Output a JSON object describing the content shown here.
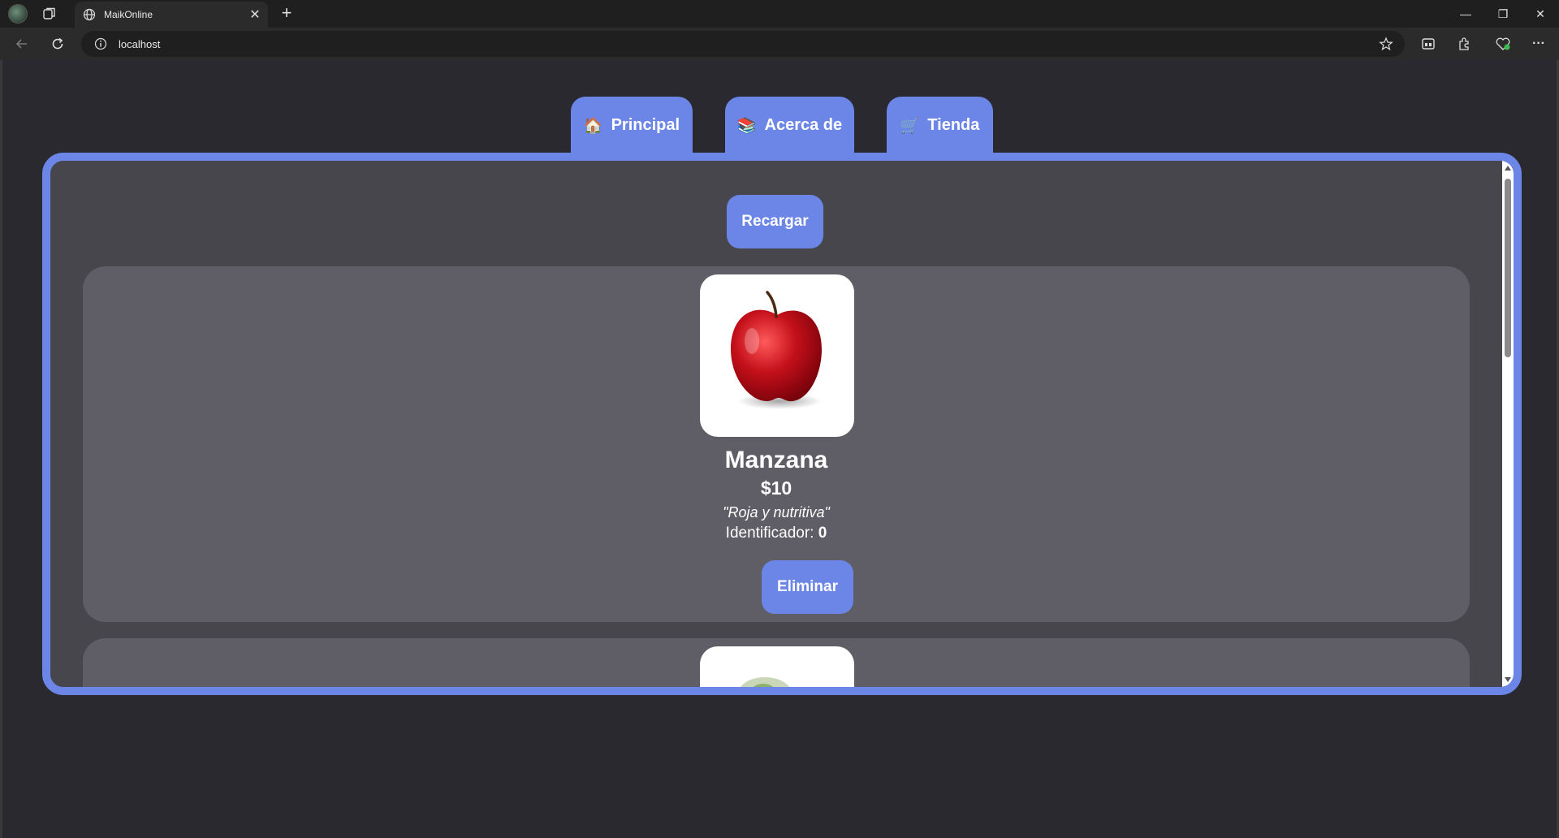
{
  "browser": {
    "tab_title": "MaikOnline",
    "close_glyph": "✕",
    "new_tab_glyph": "+",
    "url": "localhost",
    "window_controls": {
      "minimize": "—",
      "restore": "❐",
      "close": "✕"
    },
    "toolbar_more": "···"
  },
  "nav": {
    "tabs": [
      {
        "emoji": "🏠",
        "label": "Principal"
      },
      {
        "emoji": "📚",
        "label": "Acerca de"
      },
      {
        "emoji": "🛒",
        "label": "Tienda"
      }
    ]
  },
  "main": {
    "reload_label": "Recargar",
    "products": [
      {
        "name": "Manzana",
        "price": "$10",
        "description": "\"Roja y nutritiva\"",
        "id_label": "Identificador:",
        "id_value": "0",
        "delete_label": "Eliminar",
        "image": "red-apple"
      },
      {
        "image": "green-fruit"
      }
    ]
  },
  "colors": {
    "accent": "#6b86e6",
    "page_bg": "#2a292f",
    "panel_bg": "#48464d",
    "card_bg": "#5f5d66"
  }
}
